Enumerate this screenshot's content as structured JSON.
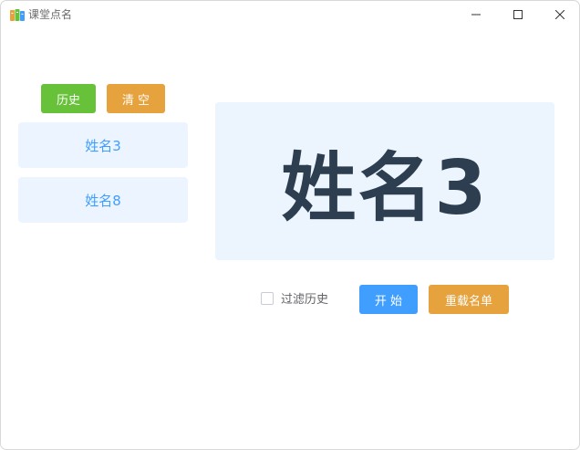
{
  "window": {
    "title": "课堂点名"
  },
  "toolbar": {
    "history_label": "历史",
    "clear_label": "清 空"
  },
  "history": {
    "items": [
      {
        "label": "姓名3"
      },
      {
        "label": "姓名8"
      }
    ]
  },
  "display": {
    "current_name": "姓名3"
  },
  "controls": {
    "filter_label": "过滤历史",
    "filter_checked": false,
    "start_label": "开 始",
    "reload_label": "重载名单"
  },
  "colors": {
    "success": "#67c23a",
    "warning": "#e6a23c",
    "primary": "#409eff",
    "name_text": "#2c3e50",
    "panel_bg": "#ecf5ff"
  },
  "icons": {
    "app": "books-icon",
    "minimize": "minimize-icon",
    "maximize": "maximize-icon",
    "close": "close-icon"
  }
}
